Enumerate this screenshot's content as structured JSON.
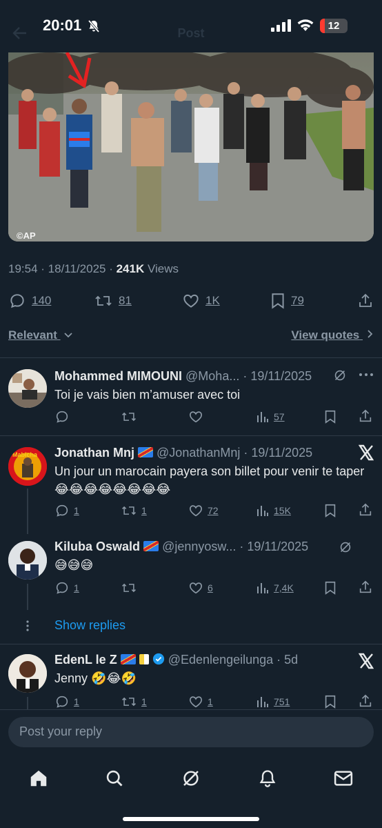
{
  "status_bar": {
    "time": "20:01",
    "battery": "12"
  },
  "header": {
    "title": "Post"
  },
  "post": {
    "image_watermark": "©AP",
    "time": "19:54",
    "date": "18/11/2025",
    "views_count": "241K",
    "views_label": "Views",
    "replies": "140",
    "reposts": "81",
    "likes": "1K",
    "bookmarks": "79"
  },
  "sort": {
    "label": "Relevant",
    "view_quotes": "View quotes"
  },
  "replies": [
    {
      "name": "Mohammed MIMOUNI",
      "handle": "@Moha...",
      "date": "· 19/11/2025",
      "text": "Toi je vais bien m’amuser avec toi",
      "comments": "",
      "reposts": "",
      "likes": "",
      "views": "57"
    },
    {
      "name": "Jonathan Mnj",
      "handle": "@JonathanMnj",
      "date": "· 19/11/2025",
      "text": "Un jour un marocain payera son billet pour venir te taper 😂😂😂😂😂😂😂😂",
      "comments": "1",
      "reposts": "1",
      "likes": "72",
      "views": "15K"
    },
    {
      "name": "Kiluba Oswald",
      "handle": "@jennyosw...",
      "date": "· 19/11/2025",
      "text": "😅😅😅",
      "comments": "1",
      "reposts": "",
      "likes": "6",
      "views": "7,4K"
    },
    {
      "name": "EdenL le Z",
      "handle": "@Edenlengeilunga",
      "date": "· 5d",
      "text": "Jenny 🤣😂🤣",
      "comments": "1",
      "reposts": "1",
      "likes": "1",
      "views": "751"
    }
  ],
  "show_replies": "Show replies",
  "compose": {
    "placeholder": "Post your reply"
  },
  "tabs": [
    "home-icon",
    "search-icon",
    "grok-icon",
    "notifications-icon",
    "messages-icon"
  ],
  "colors": {
    "background": "#15202b",
    "accent": "#1d9bf0",
    "muted": "#8b98a5"
  }
}
